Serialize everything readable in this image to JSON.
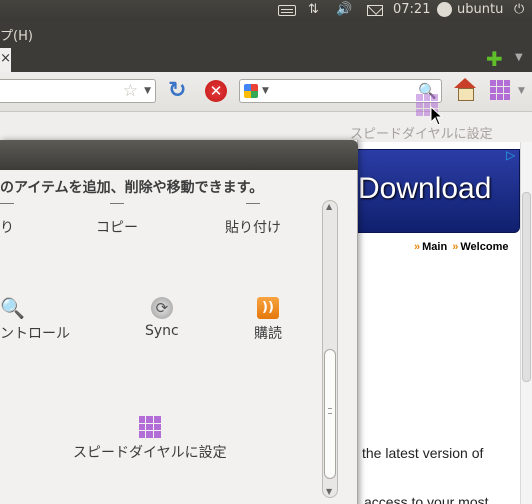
{
  "top_panel": {
    "clock": "07:21",
    "user": "ubuntu",
    "icons": [
      "keyboard-icon",
      "network-icon",
      "volume-icon",
      "mail-icon",
      "user-icon",
      "power-icon"
    ]
  },
  "menubar": {
    "help": "プ(H)"
  },
  "navbar": {
    "icons": [
      "star-icon",
      "reload-icon",
      "stop-icon",
      "google-icon",
      "search-icon",
      "home-icon",
      "speed-dial-icon"
    ]
  },
  "bookmarks": {
    "label": "スピードダイヤルに設定"
  },
  "dialog": {
    "description": "のアイテムを追加、削除や移動できます。",
    "items": {
      "cut": "り",
      "copy": "コピー",
      "paste": "貼り付け",
      "zoom": "ントロール",
      "sync": "Sync",
      "subscribe": "購読",
      "speed_dial": "スピードダイヤルに設定"
    }
  },
  "webpage": {
    "ad_text": "Download",
    "nav_main": "Main",
    "nav_welcome": "Welcome",
    "text_line1": "the latest version of",
    "text_line2": "access to your most"
  },
  "colors": {
    "panel": "#3c3b37",
    "accent_purple": "#b26ed6",
    "ad_blue": "#1a2c8c",
    "nav_orange": "#e88a12"
  }
}
